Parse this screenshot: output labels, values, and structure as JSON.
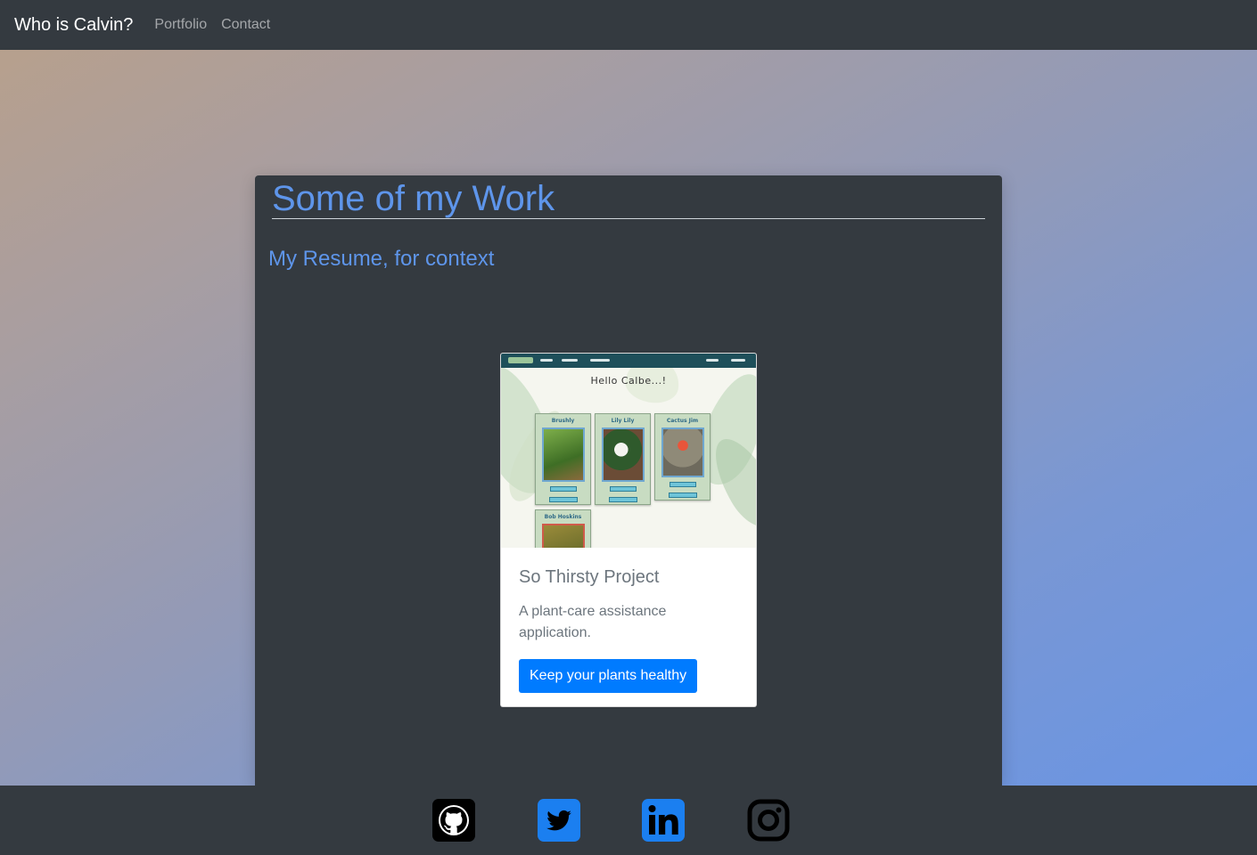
{
  "navbar": {
    "brand": "Who is Calvin?",
    "links": [
      {
        "label": "Portfolio"
      },
      {
        "label": "Contact"
      }
    ]
  },
  "main": {
    "title": "Some of my Work",
    "resume_link": "My Resume, for context"
  },
  "project_card": {
    "title": "So Thirsty Project",
    "description": "A plant-care assistance application.",
    "button_label": "Keep your plants healthy",
    "thumbnail": {
      "heading": "Hello Calbe...!",
      "plants": [
        "Brushly",
        "Lily Lily",
        "Cactus Jim",
        "Bob Hoskins"
      ]
    }
  },
  "footer": {
    "socials": [
      {
        "icon": "github-icon"
      },
      {
        "icon": "twitter-icon"
      },
      {
        "icon": "linkedin-icon"
      },
      {
        "icon": "instagram-icon"
      }
    ]
  },
  "colors": {
    "navbar_bg": "#343a40",
    "accent_blue": "#5e95ea",
    "button_blue": "#007bff",
    "social_blue": "#1b7ff0"
  }
}
